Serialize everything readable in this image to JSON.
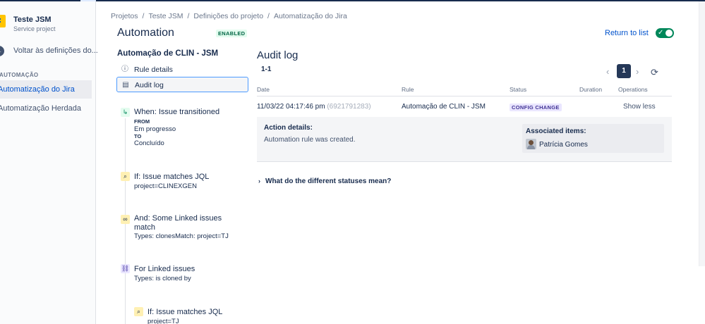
{
  "sidebar": {
    "project_name": "Teste JSM",
    "project_type": "Service project",
    "back_label": "Voltar às definições do...",
    "section_label": "AUTOMAÇÃO",
    "items": [
      {
        "label": "Automatização do Jira",
        "active": true
      },
      {
        "label": "Automatização Herdada",
        "active": false
      }
    ]
  },
  "breadcrumb": [
    "Projetos",
    "Teste JSM",
    "Definições do projeto",
    "Automatização do Jira"
  ],
  "header": {
    "title": "Automation",
    "status_badge": "ENABLED",
    "return_link": "Return to list"
  },
  "rule": {
    "name": "Automação de CLIN - JSM",
    "menu": [
      {
        "label": "Rule details",
        "icon": "info-icon"
      },
      {
        "label": "Audit log",
        "icon": "document-icon"
      }
    ],
    "components": {
      "trigger": {
        "title": "When: Issue transitioned",
        "from_label": "FROM",
        "from_value": "Em progresso",
        "to_label": "TO",
        "to_value": "Concluído"
      },
      "condition1": {
        "title": "If: Issue matches JQL",
        "sub": "project=CLINEXGEN"
      },
      "condition2": {
        "title": "And: Some Linked issues",
        "title2": "match",
        "sub": "Types: clonesMatch: project=TJ"
      },
      "branch": {
        "title": "For Linked issues",
        "sub": "Types: is cloned by"
      },
      "condition3": {
        "title": "If: Issue matches JQL",
        "sub": "project=TJ"
      }
    }
  },
  "audit": {
    "title": "Audit log",
    "count": "1-1",
    "page": "1",
    "columns": {
      "date": "Date",
      "rule": "Rule",
      "status": "Status",
      "duration": "Duration",
      "operations": "Operations"
    },
    "row": {
      "date": "11/03/22 04:17:46 pm",
      "id": "(6921791283)",
      "rule": "Automação de CLIN - JSM",
      "status": "CONFIG CHANGE",
      "duration": "",
      "operation": "Show less"
    },
    "details": {
      "heading": "Action details:",
      "text": "Automation rule was created.",
      "assoc_heading": "Associated items:",
      "assoc_name": "Patrícia Gomes"
    },
    "faq": "What do the different statuses mean?"
  }
}
